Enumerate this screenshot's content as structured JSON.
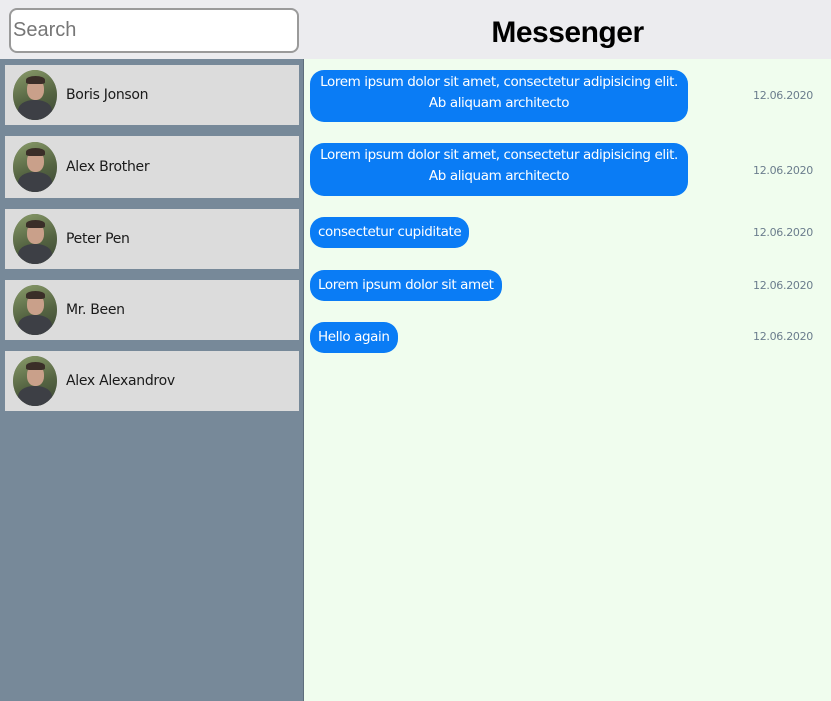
{
  "search": {
    "placeholder": "Search"
  },
  "header": {
    "title": "Messenger"
  },
  "contacts": [
    {
      "name": "Boris Jonson"
    },
    {
      "name": "Alex Brother"
    },
    {
      "name": "Peter Pen"
    },
    {
      "name": "Mr. Been"
    },
    {
      "name": "Alex Alexandrov"
    }
  ],
  "messages": [
    {
      "text": "Lorem ipsum dolor sit amet, consectetur adipisicing elit. Ab aliquam architecto",
      "time": "12.06.2020"
    },
    {
      "text": "Lorem ipsum dolor sit amet, consectetur adipisicing elit. Ab aliquam architecto",
      "time": "12.06.2020"
    },
    {
      "text": "consectetur cupiditate",
      "time": "12.06.2020"
    },
    {
      "text": "Lorem ipsum dolor sit amet",
      "time": "12.06.2020"
    },
    {
      "text": "Hello again",
      "time": "12.06.2020"
    }
  ],
  "colors": {
    "sidebar": "#778999",
    "contact_bg": "#dcdcdc",
    "chat_bg": "#f0fdee",
    "header_bg": "#ececef",
    "bubble": "#0a7cf5"
  }
}
